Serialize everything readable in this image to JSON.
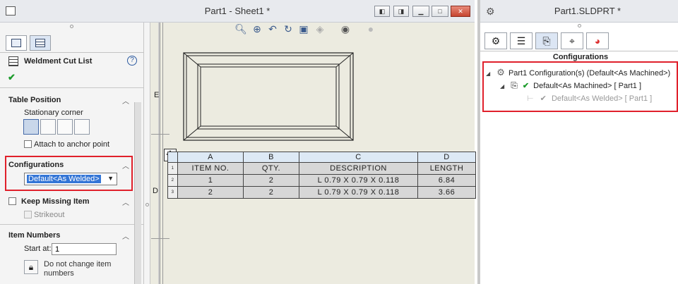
{
  "left_window": {
    "title": "Part1 - Sheet1 *"
  },
  "property_manager": {
    "header_title": "Weldment Cut List",
    "help_glyph": "?",
    "ok_glyph": "✔",
    "table_position": {
      "heading": "Table Position",
      "stationary_corner_label": "Stationary corner",
      "attach_label": "Attach to anchor point"
    },
    "configurations": {
      "heading": "Configurations",
      "selected": "Default<As Welded>"
    },
    "keep_missing_item": {
      "heading": "Keep Missing Item",
      "strikeout_label": "Strikeout"
    },
    "item_numbers": {
      "heading": "Item Numbers",
      "start_at_label": "Start at:",
      "start_at_value": "1",
      "do_not_change_label_line1": "Do not change item",
      "do_not_change_label_line2": "numbers"
    }
  },
  "drawing": {
    "zone_labels": [
      "E",
      "D"
    ],
    "table": {
      "col_letters": [
        "A",
        "B",
        "C",
        "D"
      ],
      "headers": [
        "ITEM NO.",
        "QTY.",
        "DESCRIPTION",
        "LENGTH"
      ],
      "row_numbers": [
        "1",
        "2",
        "3"
      ],
      "rows": [
        [
          "1",
          "2",
          "L 0.79 X 0.79 X 0.118",
          "6.84"
        ],
        [
          "2",
          "2",
          "L 0.79 X 0.79 X 0.118",
          "3.66"
        ]
      ]
    }
  },
  "right_panel": {
    "title": "Part1.SLDPRT *",
    "section_label": "Configurations",
    "tree": {
      "root": "Part1 Configuration(s)  (Default<As Machined>)",
      "child": "Default<As Machined> [ Part1 ]",
      "grandchild": "Default<As Welded> [ Part1 ]"
    }
  },
  "colors": {
    "highlight_box": "#e0202b",
    "selection_blue": "#3375d6",
    "check_green": "#1c9b2b"
  }
}
